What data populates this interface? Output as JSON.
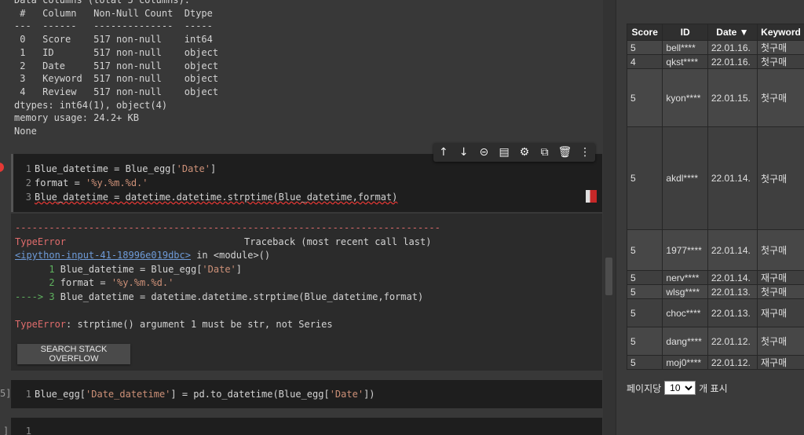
{
  "info_output": [
    "Data columns (total 5 columns):",
    " #   Column   Non-Null Count  Dtype ",
    "---  ------   --------------  ----- ",
    " 0   Score    517 non-null    int64 ",
    " 1   ID       517 non-null    object",
    " 2   Date     517 non-null    object",
    " 3   Keyword  517 non-null    object",
    " 4   Review   517 non-null    object",
    "dtypes: int64(1), object(4)",
    "memory usage: 24.2+ KB",
    "None"
  ],
  "cell1": {
    "line1_num": "1",
    "line1_code": "Blue_datetime = Blue_egg[",
    "line1_str": "'Date'",
    "line1_end": "]",
    "line2_num": "2",
    "line2_code": "format = ",
    "line2_str": "'%y.%m.%d.'",
    "line3_num": "3",
    "line3_code": "Blue_datetime = datetime.datetime.strptime(Blue_datetime,format)"
  },
  "toolbar": {
    "move_up": "↑",
    "move_down": "↓",
    "link": "⊝",
    "comment": "▤",
    "settings": "⚙",
    "mirror": "⧉",
    "delete": "🗑",
    "more": "⋮"
  },
  "error": {
    "separator": "---------------------------------------------------------------------------",
    "type": "TypeError",
    "traceback_label": "Traceback (most recent call last)",
    "input_link": "<ipython-input-41-18996e019dbc>",
    "in_module": " in <module>()",
    "tb_line1_num": "      1 ",
    "tb_line1_code": "Blue_datetime = Blue_egg[",
    "tb_line1_str": "'Date'",
    "tb_line1_end": "]",
    "tb_line2_num": "      2 ",
    "tb_line2_code": "format = ",
    "tb_line2_str": "'%y.%m.%d.'",
    "tb_arrow": "----> 3 ",
    "tb_line3_code": "Blue_datetime = datetime.datetime.strptime(Blue_datetime,format)",
    "message_type": "TypeError",
    "message": ": strptime() argument 1 must be str, not Series",
    "stack_button": "SEARCH STACK OVERFLOW"
  },
  "cell2": {
    "prompt": "5]",
    "num": "1",
    "code_a": "Blue_egg[",
    "str_a": "'Date_datetime'",
    "code_b": "] = pd.to_datetime(Blue_egg[",
    "str_b": "'Date'",
    "code_c": "])"
  },
  "cell3": {
    "prompt": "]",
    "num": "1"
  },
  "table": {
    "headers": [
      "Score",
      "ID",
      "Date ▼",
      "Keyword"
    ],
    "rows": [
      {
        "score": "5",
        "id": "bell****",
        "date": "22.01.16.",
        "keyword": "첫구매"
      },
      {
        "score": "4",
        "id": "qkst****",
        "date": "22.01.16.",
        "keyword": "첫구매"
      },
      {
        "score": "5",
        "id": "kyon****",
        "date": "22.01.15.",
        "keyword": "첫구매"
      },
      {
        "score": "5",
        "id": "akdl****",
        "date": "22.01.14.",
        "keyword": "첫구매"
      },
      {
        "score": "5",
        "id": "1977****",
        "date": "22.01.14.",
        "keyword": "첫구매"
      },
      {
        "score": "5",
        "id": "nerv****",
        "date": "22.01.14.",
        "keyword": "재구매"
      },
      {
        "score": "5",
        "id": "wlsg****",
        "date": "22.01.13.",
        "keyword": "첫구매"
      },
      {
        "score": "5",
        "id": "choc****",
        "date": "22.01.13.",
        "keyword": "재구매"
      },
      {
        "score": "5",
        "id": "dang****",
        "date": "22.01.12.",
        "keyword": "첫구매"
      },
      {
        "score": "5",
        "id": "moj0****",
        "date": "22.01.12.",
        "keyword": "재구매"
      }
    ]
  },
  "pagination": {
    "label_before": "페이지당",
    "page_size": "10",
    "label_after": "개 표시"
  }
}
